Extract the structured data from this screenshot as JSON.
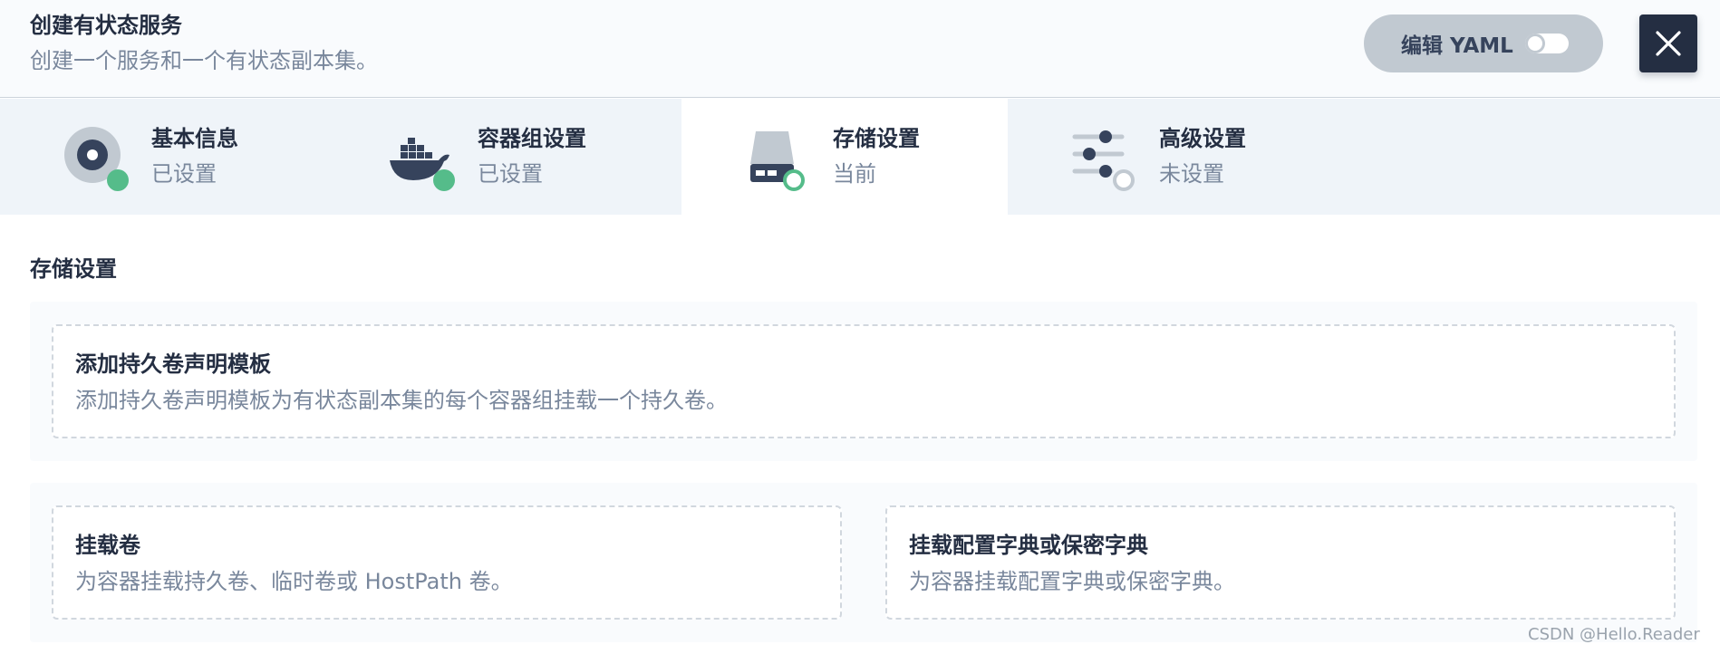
{
  "header": {
    "title": "创建有状态服务",
    "description": "创建一个服务和一个有状态副本集。",
    "edit_yaml_label": "编辑 YAML"
  },
  "steps": [
    {
      "title": "基本信息",
      "status": "已设置",
      "icon": "disc-icon",
      "state": "done"
    },
    {
      "title": "容器组设置",
      "status": "已设置",
      "icon": "docker-whale-icon",
      "state": "done"
    },
    {
      "title": "存储设置",
      "status": "当前",
      "icon": "hard-drive-icon",
      "state": "current"
    },
    {
      "title": "高级设置",
      "status": "未设置",
      "icon": "sliders-icon",
      "state": "pending"
    }
  ],
  "main": {
    "section_title": "存储设置",
    "pvc_template": {
      "title": "添加持久卷声明模板",
      "description": "添加持久卷声明模板为有状态副本集的每个容器组挂载一个持久卷。"
    },
    "mount_volume": {
      "title": "挂载卷",
      "description": "为容器挂载持久卷、临时卷或 HostPath 卷。"
    },
    "mount_config": {
      "title": "挂载配置字典或保密字典",
      "description": "为容器挂载配置字典或保密字典。"
    }
  },
  "watermark": "CSDN @Hello.Reader",
  "colors": {
    "primary_dark": "#242e42",
    "muted_text": "#79879c",
    "success_green": "#55bc8a",
    "steps_bg": "#eff4f9",
    "dashed_border": "#d1d7de"
  }
}
